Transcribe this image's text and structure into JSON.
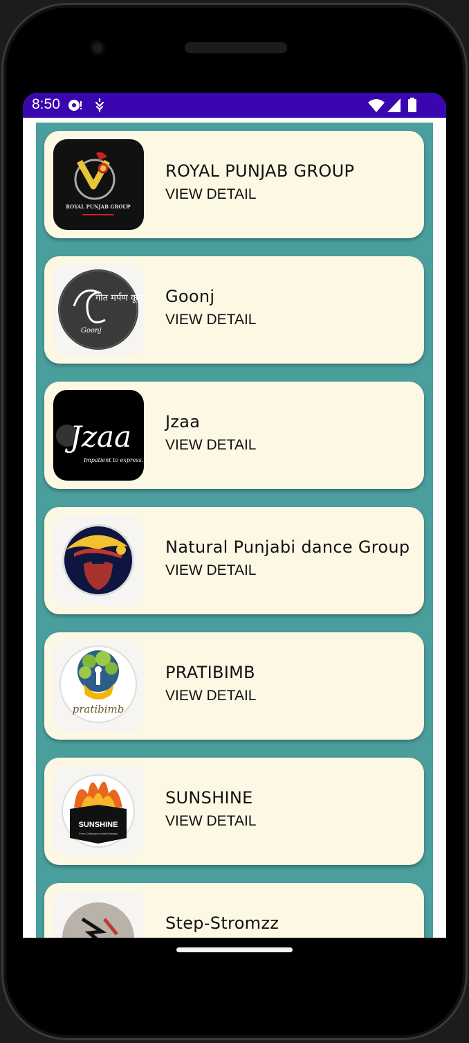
{
  "status": {
    "time": "8:50"
  },
  "groups": [
    {
      "title": "ROYAL PUNJAB GROUP",
      "action": "VIEW DETAIL"
    },
    {
      "title": "Goonj",
      "action": "VIEW DETAIL"
    },
    {
      "title": "Jzaa",
      "action": "VIEW DETAIL"
    },
    {
      "title": "Natural Punjabi dance Group",
      "action": "VIEW DETAIL"
    },
    {
      "title": "PRATIBIMB",
      "action": "VIEW DETAIL"
    },
    {
      "title": "SUNSHINE",
      "action": "VIEW DETAIL"
    },
    {
      "title": "Step-Stromzz",
      "action": ""
    }
  ],
  "logos": {
    "royal": {
      "text": "ROYAL PUNJAB GROUP"
    },
    "goonj": {
      "text": "गीत मर्पण कून",
      "sub": "Goonj"
    },
    "jzaa": {
      "text": "Jzaa",
      "sub": "Impatient to express..."
    },
    "pratibimb": {
      "text": "pratibimb"
    },
    "sunshine": {
      "text": "SUNSHINE",
      "sub": "From Ordinary to extraOrdinary"
    }
  },
  "colors": {
    "statusbar": "#3a06b0",
    "list_bg": "#4a9e9c",
    "card": "#fdf8e4"
  }
}
